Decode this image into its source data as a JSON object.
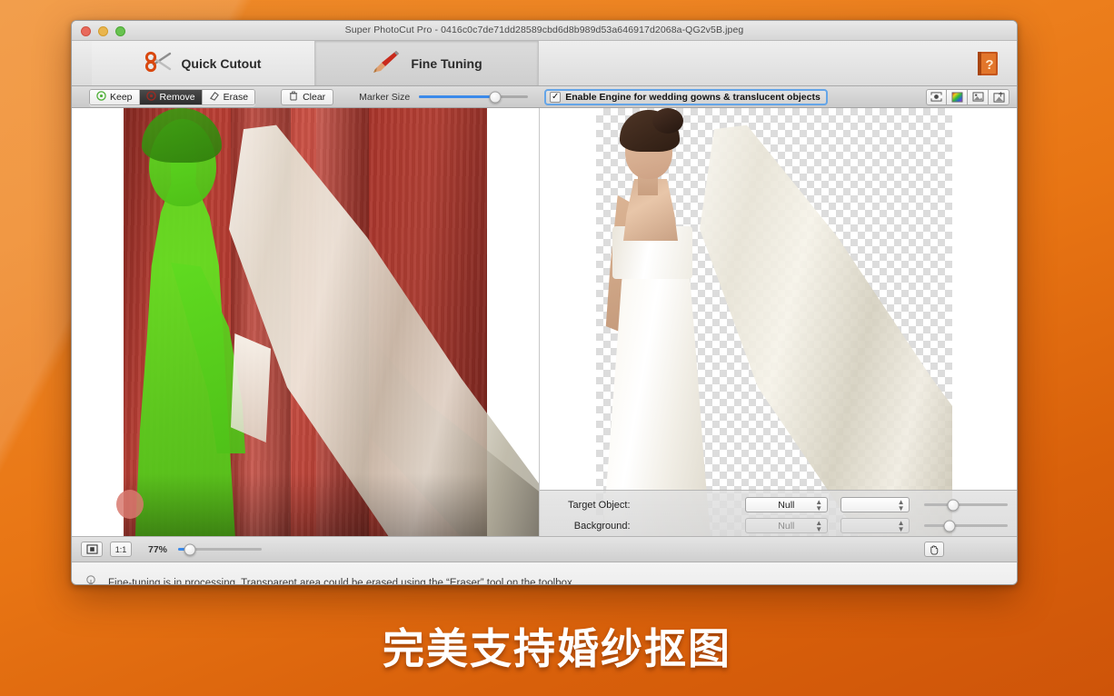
{
  "window": {
    "title": "Super PhotoCut Pro - 0416c0c7de71dd28589cbd6d8b989d53a646917d2068a-QG2v5B.jpeg",
    "traffic_lights": [
      "close",
      "minimize",
      "zoom"
    ]
  },
  "tabs": [
    {
      "label": "Quick Cutout",
      "icon": "scissors-icon",
      "active": false
    },
    {
      "label": "Fine Tuning",
      "icon": "paintbrush-icon",
      "active": true
    }
  ],
  "help": {
    "icon": "help-book-icon",
    "label": "?"
  },
  "toolbar": {
    "modes": [
      {
        "label": "Keep",
        "icon": "keep-target-icon",
        "selected": false
      },
      {
        "label": "Remove",
        "icon": "remove-target-icon",
        "selected": true
      },
      {
        "label": "Erase",
        "icon": "eraser-icon",
        "selected": false
      }
    ],
    "clear": {
      "label": "Clear",
      "icon": "trash-icon"
    },
    "marker_size": {
      "label": "Marker Size",
      "value": 70
    },
    "engine": {
      "label": "Enable Engine for wedding gowns & translucent objects",
      "checked": true,
      "check_glyph": "✓"
    },
    "icons": [
      {
        "name": "fit-frame-icon"
      },
      {
        "name": "color-picker-icon"
      },
      {
        "name": "preview-image-icon"
      },
      {
        "name": "export-image-icon"
      }
    ]
  },
  "settings": {
    "rows": [
      {
        "label": "Target Object:",
        "value": "Null",
        "secondary": "",
        "slider": 34,
        "disabled": false
      },
      {
        "label": "Background:",
        "value": "Null",
        "secondary": "",
        "slider": 30,
        "disabled": true
      }
    ]
  },
  "zoombar": {
    "fit_icon": "fit-to-window-icon",
    "actual_size": "1:1",
    "level": "77%",
    "slider": 14,
    "pan_icon": "hand-pan-icon"
  },
  "status": {
    "icon": "lightbulb-icon",
    "message": "Fine-tuning is in processing. Transparent area could be erased using the “Eraser” tool on the toolbox."
  },
  "caption": "完美支持婚纱抠图",
  "colors": {
    "desktop_top": "#f08c2a",
    "desktop_bottom": "#ce5409",
    "accent_blue": "#3b8aea",
    "highlight_border": "#64a5e8",
    "mask_green": "#5ed91f",
    "curtain_red": "#b33a2f"
  }
}
